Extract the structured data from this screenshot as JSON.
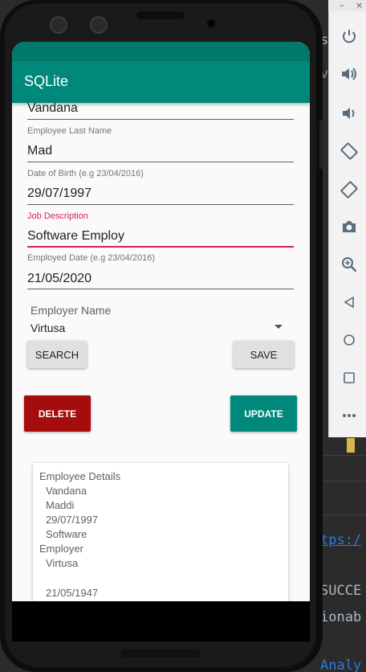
{
  "app": {
    "title": "SQLite"
  },
  "form": {
    "first_name_value": "Vandana",
    "last_name_label": "Employee Last Name",
    "last_name_value": "Mad",
    "dob_label": "Date of Birth (e.g 23/04/2016)",
    "dob_value": "29/07/1997",
    "job_label": "Job Description",
    "job_value": "Software Employ",
    "employed_label": "Employed Date (e.g 23/04/2016)",
    "employed_value": "21/05/2020",
    "employer_label": "Employer Name",
    "employer_value": "Virtusa"
  },
  "buttons": {
    "search": "SEARCH",
    "save": "SAVE",
    "delete": "DELETE",
    "update": "UPDATE"
  },
  "details": {
    "header": "Employee Details",
    "first_name": "Vandana",
    "last_name": "Maddi",
    "dob": "29/07/1997",
    "job": "Software",
    "employer_header": "Employer",
    "employer": "Virtusa",
    "employed": "21/05/1947"
  },
  "ide": {
    "lines": [
      "s",
      "v",
      "",
      "",
      "",
      "",
      "",
      "",
      "",
      "",
      "",
      "",
      "",
      "",
      "",
      "",
      "",
      "",
      "",
      "",
      "",
      "",
      "",
      "",
      "",
      "",
      "",
      "",
      "",
      "",
      ""
    ],
    "link_text": "tps:/",
    "success_text": "SUCCE",
    "ionab_text": "ionab",
    "analy_text": "Analy"
  },
  "emulator": {
    "top_controls": [
      "–",
      "×"
    ],
    "tools": [
      "power-icon",
      "volume-up-icon",
      "volume-down-icon",
      "rotate-left-icon",
      "rotate-right-icon",
      "camera-icon",
      "zoom-icon",
      "back-icon",
      "home-icon",
      "overview-icon",
      "more-icon"
    ]
  },
  "colors": {
    "primary": "#00897b",
    "primary_dark": "#00796b",
    "accent": "#d81b60",
    "delete": "#a50c0c"
  }
}
